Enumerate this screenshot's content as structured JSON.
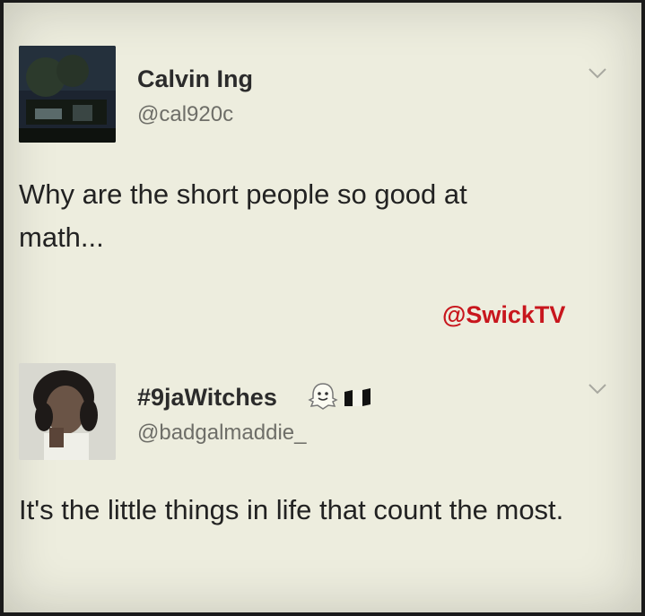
{
  "tweets": [
    {
      "name": "Calvin Ing",
      "handle": "@cal920c",
      "text": "Why are the short people so good at math..."
    },
    {
      "name": "#9jaWitches",
      "handle": "@badgalmaddie_",
      "text": "It's the little things in life that count the most."
    }
  ],
  "watermark": "@SwickTV",
  "icons": {
    "menu": "chevron-down-icon",
    "ghost": "snapchat-ghost-icon",
    "flag": "nigeria-flag-icon"
  },
  "colors": {
    "background": "#ededde",
    "watermark": "#c8161d",
    "text": "#222222",
    "handle": "#6e6e68"
  }
}
